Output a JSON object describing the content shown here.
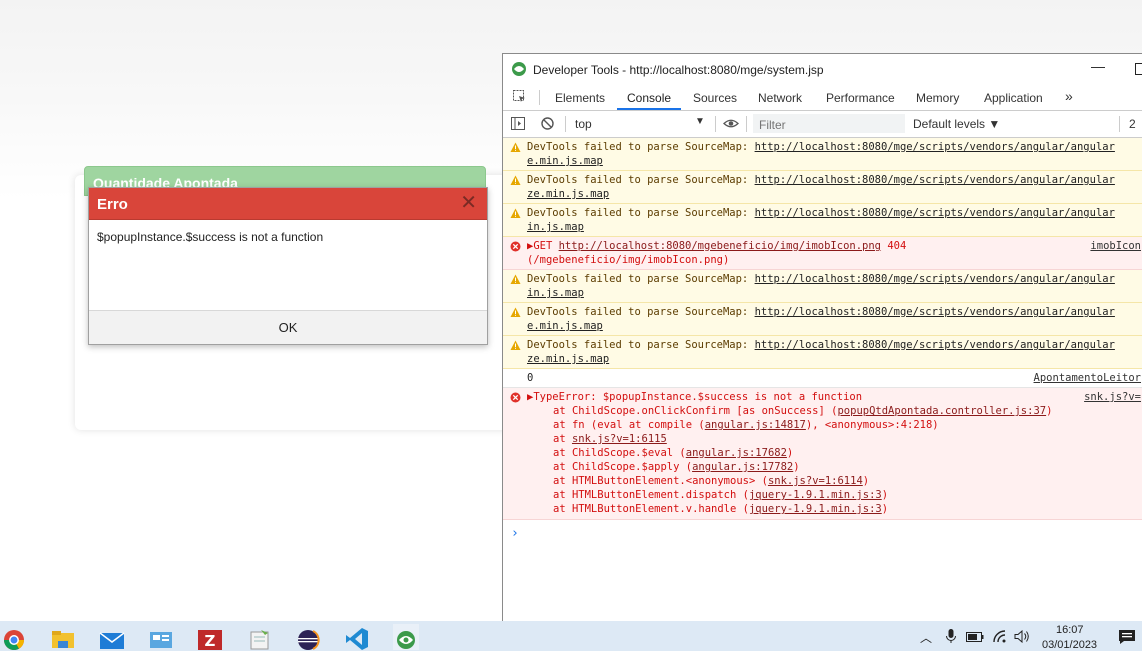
{
  "background": {
    "panel_title": "Quantidade Apontada"
  },
  "dialog": {
    "title": "Erro",
    "close_glyph": "✕",
    "message": "$popupInstance.$success is not a function",
    "ok_label": "OK"
  },
  "devtools": {
    "title": "Developer Tools - http://localhost:8080/mge/system.jsp",
    "min_glyph": "—",
    "tabs": [
      "Elements",
      "Console",
      "Sources",
      "Network",
      "Performance",
      "Memory",
      "Application"
    ],
    "more_tabs": "»",
    "toolbar": {
      "context": "top",
      "filter_placeholder": "Filter",
      "levels": "Default levels ▼",
      "issues_count": "2"
    },
    "messages": [
      {
        "prefix": "DevTools failed to parse SourceMap: ",
        "link": "http://localhost:8080/mge/scripts/vendors/angular/angular",
        "cont": "e.min.js.map"
      },
      {
        "prefix": "DevTools failed to parse SourceMap: ",
        "link": "http://localhost:8080/mge/scripts/vendors/angular/angular",
        "cont": "ze.min.js.map"
      },
      {
        "prefix": "DevTools failed to parse SourceMap: ",
        "link": "http://localhost:8080/mge/scripts/vendors/angular/angular",
        "cont": "in.js.map"
      },
      {
        "prefix": "DevTools failed to parse SourceMap: ",
        "link": "http://localhost:8080/mge/scripts/vendors/angular/angular",
        "cont": "in.js.map"
      },
      {
        "prefix": "DevTools failed to parse SourceMap: ",
        "link": "http://localhost:8080/mge/scripts/vendors/angular/angular",
        "cont": "e.min.js.map"
      },
      {
        "prefix": "DevTools failed to parse SourceMap: ",
        "link": "http://localhost:8080/mge/scripts/vendors/angular/angular",
        "cont": "ze.min.js.map"
      }
    ],
    "get_error": {
      "method": "▶GET ",
      "url": "http://localhost:8080/mgebeneficio/img/imobIcon.png",
      "status": " 404",
      "path": "(/mgebeneficio/img/imobIcon.png)",
      "source": "imobIcon"
    },
    "log": {
      "value": "0",
      "source": "ApontamentoLeitor"
    },
    "type_error": {
      "head": "▶TypeError: $popupInstance.$success is not a function",
      "source": "snk.js?v=",
      "trace": [
        {
          "pre": "at ChildScope.onClickConfirm [as onSuccess] (",
          "link": "popupQtdApontada.controller.js:37",
          "post": ")"
        },
        {
          "pre": "at fn (eval at compile (",
          "link": "angular.js:14817",
          "post": "), <anonymous>:4:218)"
        },
        {
          "pre": "at ",
          "link": "snk.js?v=1:6115",
          "post": ""
        },
        {
          "pre": "at ChildScope.$eval (",
          "link": "angular.js:17682",
          "post": ")"
        },
        {
          "pre": "at ChildScope.$apply (",
          "link": "angular.js:17782",
          "post": ")"
        },
        {
          "pre": "at HTMLButtonElement.<anonymous> (",
          "link": "snk.js?v=1:6114",
          "post": ")"
        },
        {
          "pre": "at HTMLButtonElement.dispatch (",
          "link": "jquery-1.9.1.min.js:3",
          "post": ")"
        },
        {
          "pre": "at HTMLButtonElement.v.handle (",
          "link": "jquery-1.9.1.min.js:3",
          "post": ")"
        }
      ]
    },
    "prompt": "›"
  },
  "taskbar": {
    "apps": [
      "chrome-icon",
      "file-explorer-icon",
      "mail-icon",
      "control-panel-icon",
      "filezilla-icon",
      "notepad-icon",
      "eclipse-icon",
      "vscode-icon",
      "sankhya-icon"
    ],
    "time": "16:07",
    "date": "03/01/2023"
  },
  "colors": {
    "dialog_header": "#d9453a",
    "panel_header": "#9fd5a0",
    "active_tab": "#1a73e8",
    "error_text": "#d30f0f",
    "warn_bg": "#fffbe5",
    "error_bg": "#fff0f0"
  }
}
